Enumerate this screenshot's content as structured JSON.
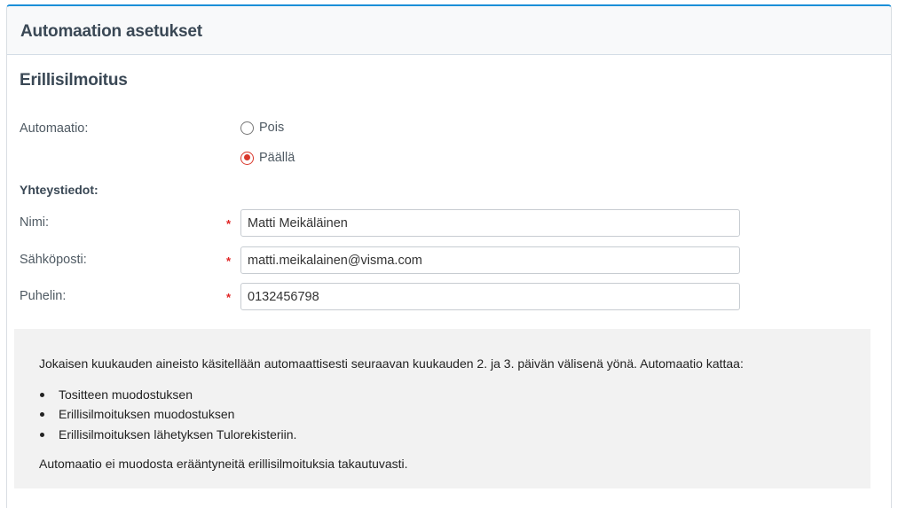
{
  "panel": {
    "title": "Automaation asetukset"
  },
  "section": {
    "title": "Erillisilmoitus"
  },
  "automation": {
    "label": "Automaatio:",
    "options": [
      {
        "label": "Pois",
        "selected": false
      },
      {
        "label": "Päällä",
        "selected": true
      }
    ]
  },
  "contact": {
    "heading": "Yhteystiedot:",
    "required_marker": "*",
    "name": {
      "label": "Nimi:",
      "value": "Matti Meikäläinen"
    },
    "email": {
      "label": "Sähköposti:",
      "value": "matti.meikalainen@visma.com"
    },
    "phone": {
      "label": "Puhelin:",
      "value": "0132456798"
    }
  },
  "info": {
    "intro": "Jokaisen kuukauden aineisto käsitellään automaattisesti seuraavan kuukauden 2. ja 3. päivän välisenä yönä. Automaatio kattaa:",
    "items": [
      "Tositteen muodostuksen",
      "Erillisilmoituksen muodostuksen",
      "Erillisilmoituksen lähetyksen Tulorekisteriin."
    ],
    "footer": "Automaatio ei muodosta erääntyneitä erillisilmoituksia takautuvasti."
  },
  "colors": {
    "accent": "#1b8fd8",
    "radio_selected": "#d9372b",
    "required": "#e02424",
    "info_background": "#f2f2f2"
  }
}
